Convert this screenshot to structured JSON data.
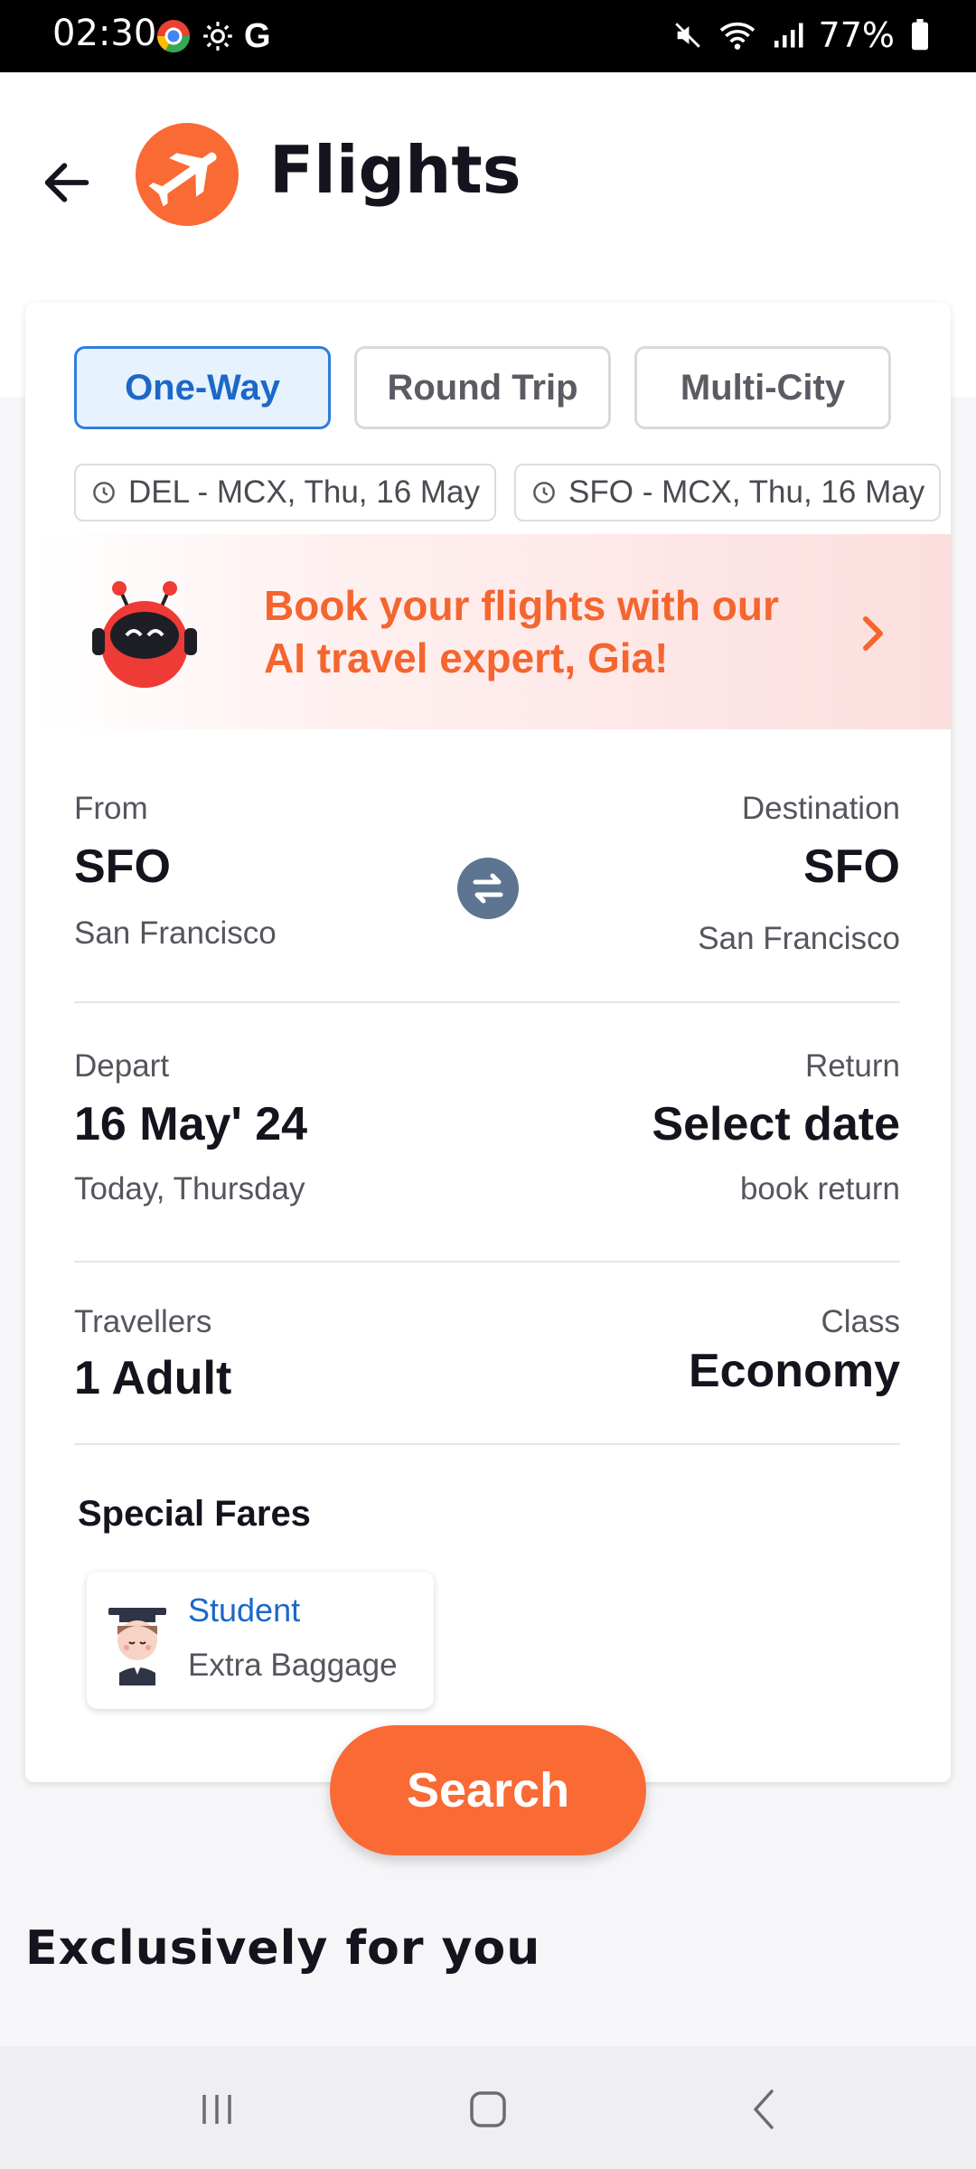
{
  "status_bar": {
    "time": "02:30",
    "battery": "77%"
  },
  "header": {
    "title": "Flights"
  },
  "trip_types": [
    {
      "label": "One-Way",
      "active": true
    },
    {
      "label": "Round Trip",
      "active": false
    },
    {
      "label": "Multi-City",
      "active": false
    }
  ],
  "recent_searches": [
    "DEL - MCX, Thu, 16 May",
    "SFO - MCX, Thu, 16 May"
  ],
  "promo": {
    "line1": "Book your flights with our",
    "line2": "AI travel expert, Gia!"
  },
  "route": {
    "from_label": "From",
    "from_code": "SFO",
    "from_city": "San Francisco",
    "dest_label": "Destination",
    "dest_code": "SFO",
    "dest_city": "San Francisco"
  },
  "dates": {
    "depart_label": "Depart",
    "depart_value": "16 May' 24",
    "depart_sub": "Today, Thursday",
    "return_label": "Return",
    "return_value": "Select date",
    "return_sub": "book return"
  },
  "travellers": {
    "label": "Travellers",
    "value": "1 Adult",
    "class_label": "Class",
    "class_value": "Economy"
  },
  "special_fares": {
    "title": "Special Fares",
    "items": [
      {
        "name": "Student",
        "desc": "Extra Baggage"
      }
    ]
  },
  "search_button": "Search",
  "exclusive_title": "Exclusively for you",
  "colors": {
    "accent": "#f96a34",
    "active_tab_bg": "#e6f2fd",
    "active_tab_border": "#2f7fdc",
    "link_blue": "#1d67c8",
    "swap_button": "#5d7590"
  }
}
